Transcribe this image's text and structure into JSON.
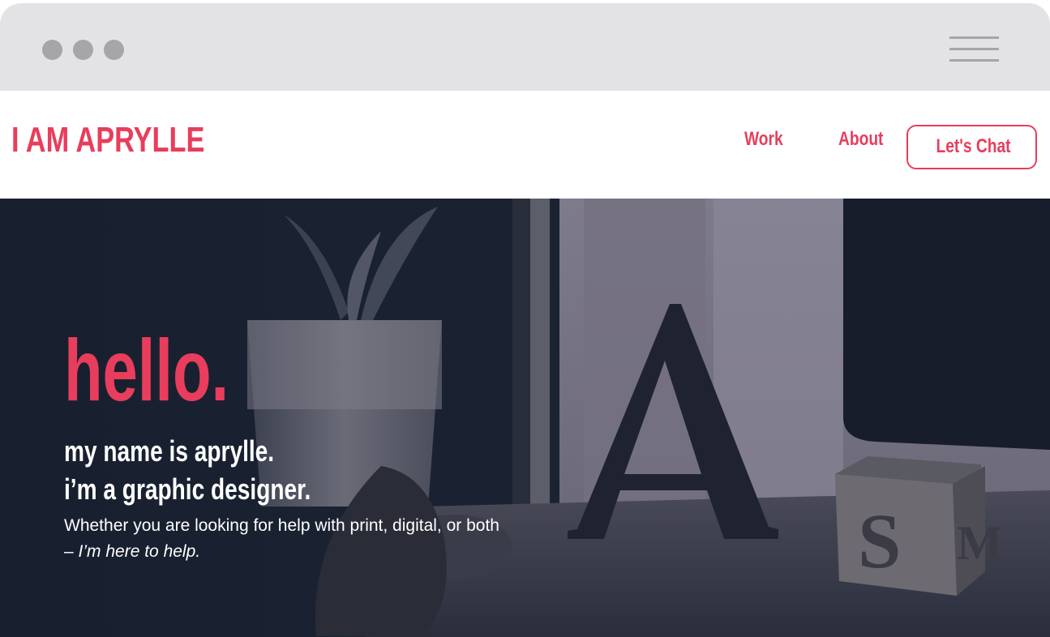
{
  "window": {
    "controls": [
      "window-dot",
      "window-dot",
      "window-dot"
    ],
    "menu_icon": "hamburger-menu-icon"
  },
  "header": {
    "logo": "I AM APRYLLE",
    "nav": {
      "work": "Work",
      "about": "About",
      "chat": "Let's Chat"
    }
  },
  "hero": {
    "greeting": "hello.",
    "line1": "my name is aprylle.",
    "line2": "i’m a graphic designer.",
    "description": "Whether you are looking for help with print, digital, or both –",
    "description_emphasis": "I’m here to help."
  },
  "colors": {
    "accent": "#e83d5c",
    "hero_bg": "#1a2232",
    "chrome": "#e3e3e6",
    "chrome_icon": "#a6a6a8"
  }
}
